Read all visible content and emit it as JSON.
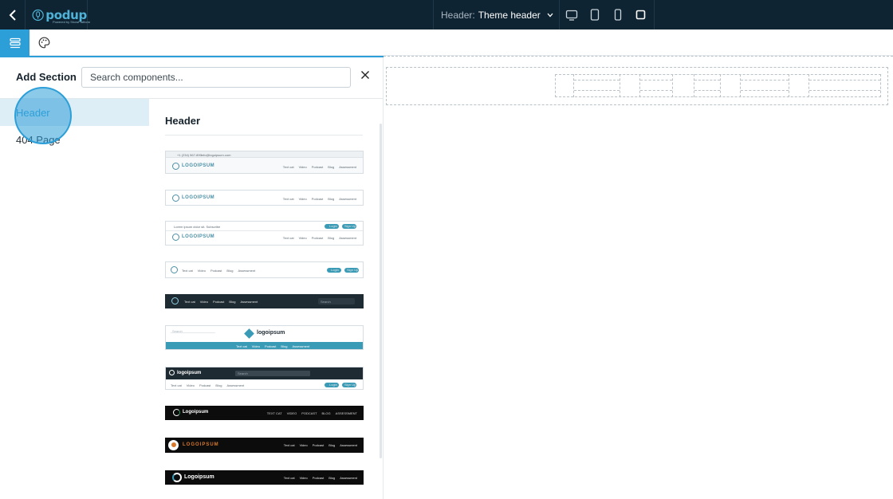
{
  "topbar": {
    "logo_text": "podup",
    "logo_tagline": "Powered by ShowPlatform",
    "header_label": "Header:",
    "header_value": "Theme header"
  },
  "panel": {
    "title": "Add Section",
    "search_placeholder": "Search components...",
    "categories": [
      {
        "label": "Header",
        "active": true
      },
      {
        "label": "404 Page",
        "active": false
      }
    ],
    "section_heading": "Header"
  },
  "thumbnails": {
    "t1": {
      "phone": "+1 (234) 567-890",
      "email": "info@logoipsum.com",
      "logo": "LOGOIPSUM",
      "links": [
        "Text cat",
        "Video",
        "Podcast",
        "Blog",
        "Assessment"
      ]
    },
    "t2": {
      "logo": "LOGOIPSUM",
      "links": [
        "Text cat",
        "Video",
        "Podcast",
        "Blog",
        "Assessment"
      ]
    },
    "t3": {
      "notice": "Lorem ipsum dolor sit. Subscribe",
      "login": "Login",
      "signup": "Sign Up",
      "logo": "LOGOIPSUM",
      "links": [
        "Text cat",
        "Video",
        "Podcast",
        "Blog",
        "Assessment"
      ]
    },
    "t4": {
      "links": [
        "Text cat",
        "Video",
        "Podcast",
        "Blog",
        "Assessment"
      ],
      "login": "Login",
      "signup": "Sign Up"
    },
    "t5": {
      "links": [
        "Text cat",
        "Video",
        "Podcast",
        "Blog",
        "Assessment"
      ],
      "search": "Search"
    },
    "t6": {
      "search": "Search",
      "logo": "logoipsum",
      "links": [
        "Text cat",
        "Video",
        "Podcast",
        "Blog",
        "Assessment"
      ]
    },
    "t7": {
      "logo": "logoipsum",
      "search": "Search",
      "links": [
        "Text cat",
        "Video",
        "Podcast",
        "Blog",
        "Assessment"
      ],
      "login": "Login",
      "signup": "Sign Up"
    },
    "t8": {
      "logo": "Logoipsum",
      "links": [
        "TEXT CAT",
        "VIDEO",
        "PODCAST",
        "BLOG",
        "ASSESSMENT"
      ]
    },
    "t9": {
      "logo": "LOGOIPSUM",
      "links": [
        "Text cat",
        "Video",
        "Podcast",
        "Blog",
        "Assessment"
      ]
    },
    "t10": {
      "logo": "Logoipsum",
      "links": [
        "Text cat",
        "Video",
        "Podcast",
        "Blog",
        "Assessment"
      ]
    }
  },
  "colors": {
    "accent": "#2d9fd8",
    "topbar": "#0f2432",
    "thumb_teal": "#3a9bb7"
  }
}
